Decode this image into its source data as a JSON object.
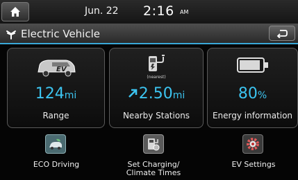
{
  "status": {
    "date": "Jun. 22",
    "time": "2:16",
    "ampm": "AM"
  },
  "header": {
    "title": "Electric Vehicle"
  },
  "cards": [
    {
      "icon": "ev-car-icon",
      "value": "124",
      "unit": "mi",
      "label": "Range"
    },
    {
      "icon": "charging-station-icon",
      "caption": "(nearest)",
      "value": "2.50",
      "unit": "mi",
      "label": "Nearby Stations"
    },
    {
      "icon": "battery-icon",
      "value": "80",
      "unit": "%",
      "label": "Energy information"
    }
  ],
  "bottom": [
    {
      "icon": "eco-driving-icon",
      "label": "ECO Driving"
    },
    {
      "icon": "charging-schedule-icon",
      "label": "Set Charging/ Climate Times"
    },
    {
      "icon": "gear-icon",
      "label": "EV Settings"
    }
  ],
  "colors": {
    "accent": "#3cc4f0",
    "divider": "#3aa8d8"
  }
}
